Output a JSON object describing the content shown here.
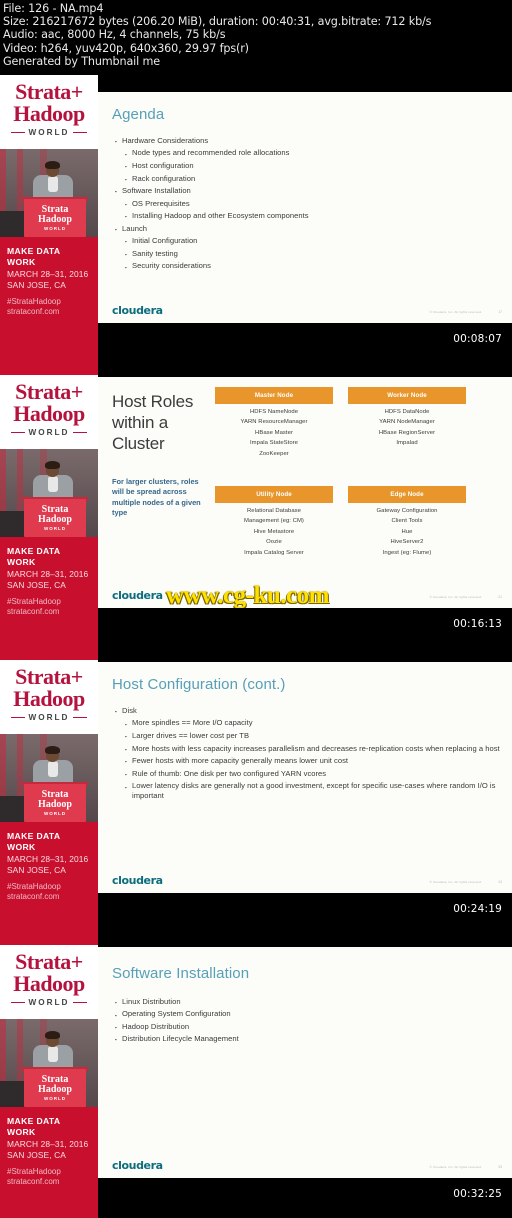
{
  "file_info": {
    "line1": "File: 126 - NA.mp4",
    "line2": "Size: 216217672 bytes (206.20 MiB), duration: 00:40:31, avg.bitrate: 712 kb/s",
    "line3": "Audio: aac, 8000 Hz, 4 channels, 75 kb/s",
    "line4": "Video: h264, yuv420p, 640x360, 29.97 fps(r)",
    "line5": "Generated by Thumbnail me"
  },
  "branding": {
    "logo_line1": "Strata+",
    "logo_line2": "Hadoop",
    "logo_world": "WORLD",
    "podium_line1": "Strata",
    "podium_line2": "Hadoop",
    "podium_line3": "WORLD",
    "tagline": "MAKE DATA WORK",
    "dates": "MARCH 28–31, 2016",
    "city": "SAN JOSE, CA",
    "hashtag": "#StrataHadoop",
    "url": "strataconf.com",
    "red": "#c8102e",
    "crimson": "#b5123e"
  },
  "slide_common": {
    "cloudera_logo": "cloudera",
    "copyright": "© Cloudera, Inc. All rights reserved.",
    "title_color": "#57a0b8",
    "accent_orange": "#e8962b"
  },
  "watermark": "www.cg-ku.com",
  "thumbnails": [
    {
      "timestamp": "00:08:07",
      "page_number": "17",
      "slide": {
        "kind": "bullets",
        "title": "Agenda",
        "bullets": [
          {
            "level": 1,
            "text": "Hardware Considerations"
          },
          {
            "level": 2,
            "text": "Node types and recommended role allocations"
          },
          {
            "level": 2,
            "text": "Host configuration"
          },
          {
            "level": 2,
            "text": "Rack configuration"
          },
          {
            "level": 1,
            "text": "Software Installation"
          },
          {
            "level": 2,
            "text": "OS Prerequisites"
          },
          {
            "level": 2,
            "text": "Installing Hadoop and other Ecosystem components"
          },
          {
            "level": 1,
            "text": "Launch"
          },
          {
            "level": 2,
            "text": "Initial Configuration"
          },
          {
            "level": 2,
            "text": "Sanity testing"
          },
          {
            "level": 2,
            "text": "Security considerations"
          }
        ]
      }
    },
    {
      "timestamp": "00:16:13",
      "page_number": "21",
      "slide": {
        "kind": "host-roles",
        "title": "Host Roles within a Cluster",
        "note": "For larger clusters, roles will be spread across multiple nodes of a given type",
        "columns": [
          {
            "header": "Master Node",
            "items": [
              "HDFS NameNode",
              "YARN ResourceManager",
              "HBase Master",
              "Impala StateStore",
              "ZooKeeper"
            ]
          },
          {
            "header": "Worker Node",
            "items": [
              "HDFS DataNode",
              "YARN NodeManager",
              "HBase RegionServer",
              "Impalad"
            ]
          },
          {
            "header": "Utility Node",
            "items": [
              "Relational Database",
              "Management (eg: CM)",
              "Hive Metastore",
              "Oozie",
              "Impala Catalog Server"
            ]
          },
          {
            "header": "Edge Node",
            "items": [
              "Gateway Configuration",
              "Client Tools",
              "Hue",
              "HiveServer2",
              "Ingest (eg: Flume)"
            ]
          }
        ]
      }
    },
    {
      "timestamp": "00:24:19",
      "page_number": "24",
      "slide": {
        "kind": "bullets",
        "title": "Host Configuration (cont.)",
        "bullets": [
          {
            "level": 1,
            "text": "Disk"
          },
          {
            "level": 2,
            "text": "More spindles == More I/O capacity"
          },
          {
            "level": 2,
            "text": "Larger drives == lower cost per TB"
          },
          {
            "level": 2,
            "text": "More hosts with less capacity increases parallelism and decreases re-replication costs when replacing a host"
          },
          {
            "level": 2,
            "text": "Fewer hosts with more capacity generally means lower unit cost"
          },
          {
            "level": 2,
            "text": "Rule of thumb: One disk per two configured YARN vcores"
          },
          {
            "level": 2,
            "text": "Lower latency disks are generally not a good investment, except for specific use-cases where random I/O is important"
          }
        ]
      }
    },
    {
      "timestamp": "00:32:25",
      "page_number": "33",
      "slide": {
        "kind": "bullets",
        "title": "Software Installation",
        "bullets": [
          {
            "level": 1,
            "text": "Linux Distribution"
          },
          {
            "level": 1,
            "text": "Operating System Configuration"
          },
          {
            "level": 1,
            "text": "Hadoop Distribution"
          },
          {
            "level": 1,
            "text": "Distribution Lifecycle Management"
          }
        ]
      }
    }
  ]
}
